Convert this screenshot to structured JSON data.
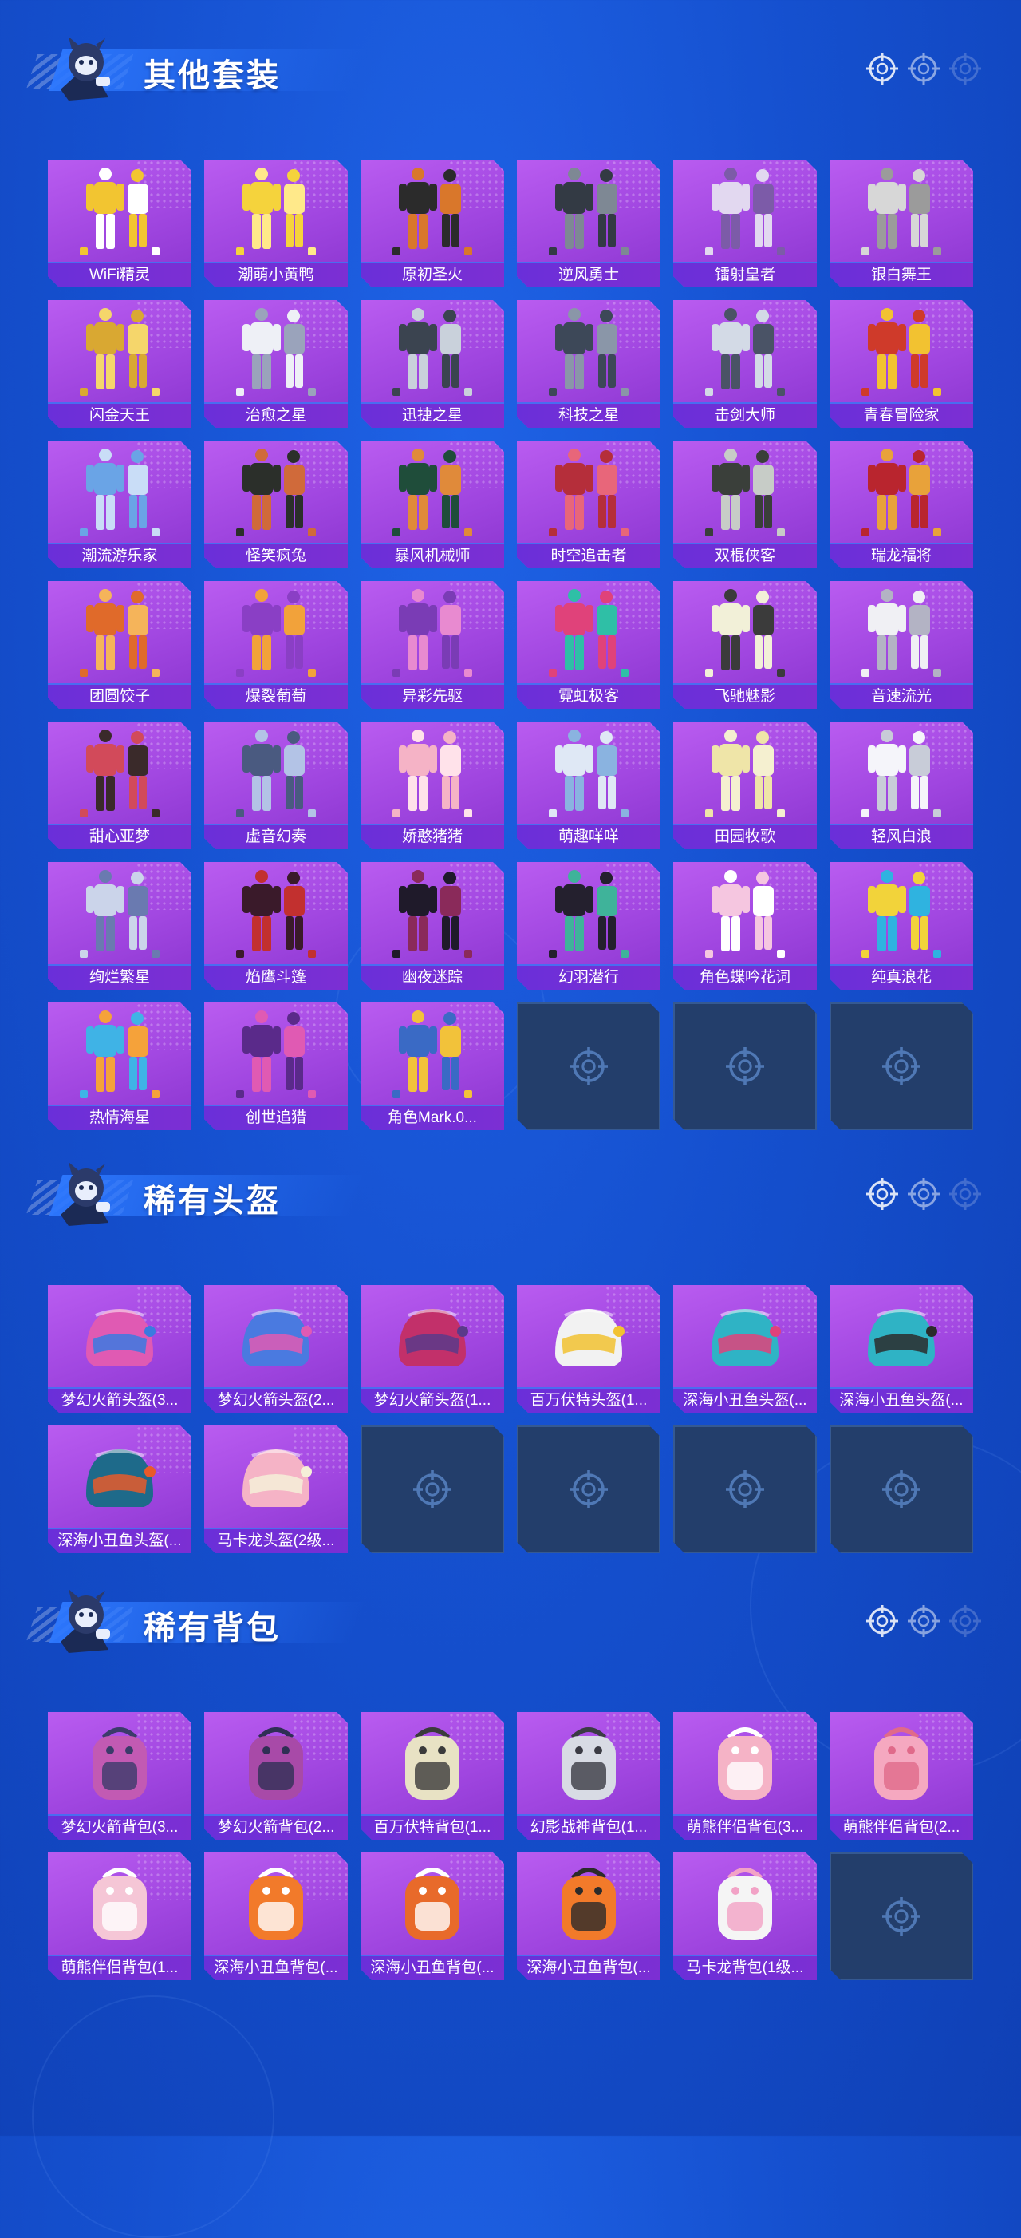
{
  "sections": [
    {
      "title": "其他套装",
      "item_type": "outfit",
      "items": [
        "WiFi精灵",
        "潮萌小黄鸭",
        "原初圣火",
        "逆风勇士",
        "镭射皇者",
        "银白舞王",
        "闪金天王",
        "治愈之星",
        "迅捷之星",
        "科技之星",
        "击剑大师",
        "青春冒险家",
        "潮流游乐家",
        "怪笑疯兔",
        "暴风机械师",
        "时空追击者",
        "双棍侠客",
        "瑞龙福将",
        "团圆饺子",
        "爆裂葡萄",
        "异彩先驱",
        "霓虹极客",
        "飞驰魅影",
        "音速流光",
        "甜心亚梦",
        "虚音幻奏",
        "娇憨猪猪",
        "萌趣咩咩",
        "田园牧歌",
        "轻风白浪",
        "绚烂繁星",
        "焰鹰斗篷",
        "幽夜迷踪",
        "幻羽潜行",
        "角色蝶吟花词",
        "纯真浪花",
        "热情海星",
        "创世追猎",
        "角色Mark.0..."
      ],
      "empty_slots": 3
    },
    {
      "title": "稀有头盔",
      "item_type": "helmet",
      "items": [
        "梦幻火箭头盔(3...",
        "梦幻火箭头盔(2...",
        "梦幻火箭头盔(1...",
        "百万伏特头盔(1...",
        "深海小丑鱼头盔(...",
        "深海小丑鱼头盔(...",
        "深海小丑鱼头盔(...",
        "马卡龙头盔(2级..."
      ],
      "empty_slots": 4
    },
    {
      "title": "稀有背包",
      "item_type": "backpack",
      "items": [
        "梦幻火箭背包(3...",
        "梦幻火箭背包(2...",
        "百万伏特背包(1...",
        "幻影战神背包(1...",
        "萌熊伴侣背包(3...",
        "萌熊伴侣背包(2...",
        "萌熊伴侣背包(1...",
        "深海小丑鱼背包(...",
        "深海小丑鱼背包(...",
        "深海小丑鱼背包(...",
        "马卡龙背包(1级..."
      ],
      "empty_slots": 1
    }
  ],
  "icons": {
    "header_right": [
      "crosshair-icon",
      "crosshair-icon",
      "crosshair-icon"
    ],
    "empty_slot": "crosshair-icon",
    "mascot": "mascot-icon"
  },
  "colors": {
    "background": "#1550cf",
    "card_purple": "#a046e0",
    "label_bar": "#6a2fd9",
    "empty_slot": "#233e6b"
  }
}
